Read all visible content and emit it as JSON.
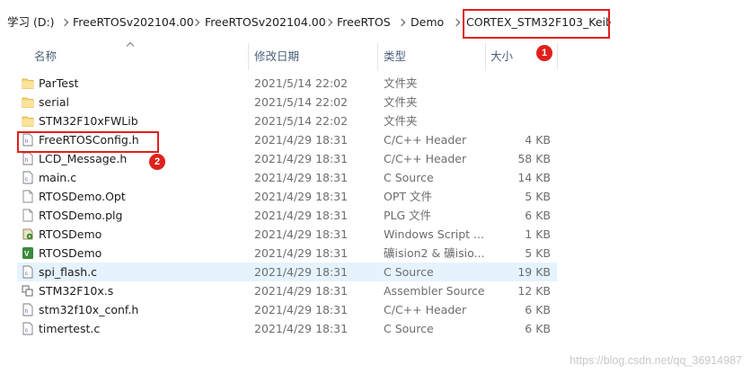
{
  "breadcrumb": {
    "items": [
      "学习 (D:)",
      "FreeRTOSv202104.00",
      "FreeRTOSv202104.00",
      "FreeRTOS",
      "Demo",
      "CORTEX_STM32F103_Keil"
    ]
  },
  "columns": {
    "name": "名称",
    "date": "修改日期",
    "type": "类型",
    "size": "大小"
  },
  "files": [
    {
      "name": "ParTest",
      "date": "2021/5/14 22:02",
      "type": "文件夹",
      "size": "",
      "icon": "folder-icon"
    },
    {
      "name": "serial",
      "date": "2021/5/14 22:02",
      "type": "文件夹",
      "size": "",
      "icon": "folder-icon"
    },
    {
      "name": "STM32F10xFWLib",
      "date": "2021/5/14 22:02",
      "type": "文件夹",
      "size": "",
      "icon": "folder-icon"
    },
    {
      "name": "FreeRTOSConfig.h",
      "date": "2021/4/29 18:31",
      "type": "C/C++ Header",
      "size": "4 KB",
      "icon": "h-file-icon"
    },
    {
      "name": "LCD_Message.h",
      "date": "2021/4/29 18:31",
      "type": "C/C++ Header",
      "size": "58 KB",
      "icon": "h-file-icon"
    },
    {
      "name": "main.c",
      "date": "2021/4/29 18:31",
      "type": "C Source",
      "size": "14 KB",
      "icon": "c-file-icon"
    },
    {
      "name": "RTOSDemo.Opt",
      "date": "2021/4/29 18:31",
      "type": "OPT 文件",
      "size": "5 KB",
      "icon": "file-icon"
    },
    {
      "name": "RTOSDemo.plg",
      "date": "2021/4/29 18:31",
      "type": "PLG 文件",
      "size": "6 KB",
      "icon": "file-icon"
    },
    {
      "name": "RTOSDemo",
      "date": "2021/4/29 18:31",
      "type": "Windows Script ...",
      "size": "1 KB",
      "icon": "script-icon"
    },
    {
      "name": "RTOSDemo",
      "date": "2021/4/29 18:31",
      "type": "礦ision2 & 礦isio...",
      "size": "5 KB",
      "icon": "keil-icon"
    },
    {
      "name": "spi_flash.c",
      "date": "2021/4/29 18:31",
      "type": "C Source",
      "size": "19 KB",
      "icon": "c-file-icon",
      "selected": true
    },
    {
      "name": "STM32F10x.s",
      "date": "2021/4/29 18:31",
      "type": "Assembler Source",
      "size": "12 KB",
      "icon": "asm-file-icon"
    },
    {
      "name": "stm32f10x_conf.h",
      "date": "2021/4/29 18:31",
      "type": "C/C++ Header",
      "size": "6 KB",
      "icon": "h-file-icon"
    },
    {
      "name": "timertest.c",
      "date": "2021/4/29 18:31",
      "type": "C Source",
      "size": "6 KB",
      "icon": "c-file-icon"
    }
  ],
  "annotations": {
    "badge1": "1",
    "badge2": "2"
  },
  "watermark": "https://blog.csdn.net/qq_36914987",
  "colors": {
    "accent_red": "#e0201c",
    "selected_row": "#e5f3ff",
    "folder": "#f8d775"
  }
}
